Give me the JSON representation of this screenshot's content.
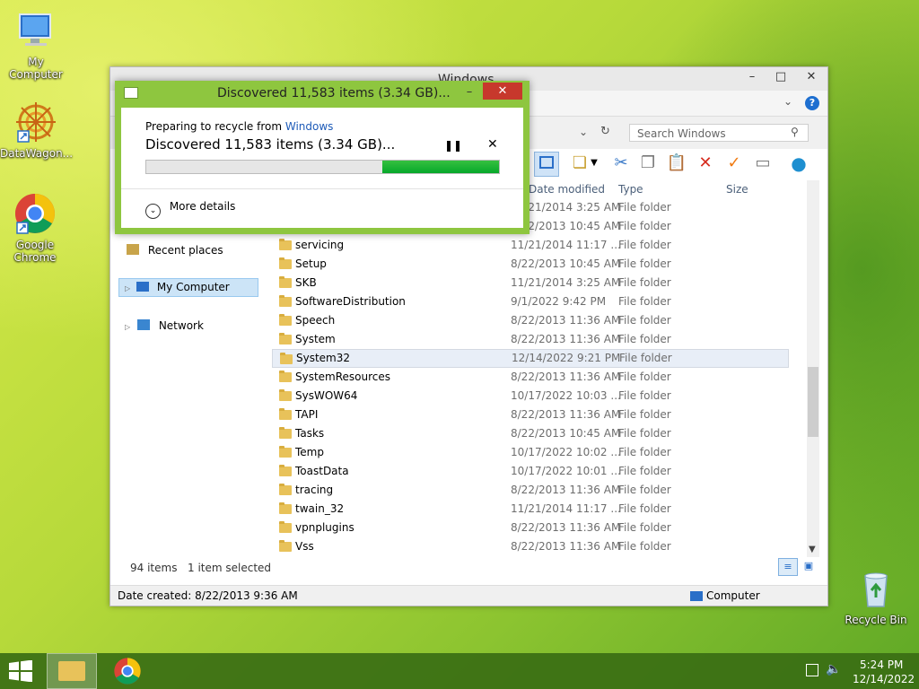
{
  "desktop": {
    "icons": [
      {
        "label": "My Computer",
        "icon": "computer-icon"
      },
      {
        "label": "DataWagon...",
        "icon": "datawagon-icon"
      },
      {
        "label": "Google Chrome",
        "icon": "chrome-icon"
      },
      {
        "label": "Recycle Bin",
        "icon": "recycle-bin-icon"
      }
    ]
  },
  "explorer": {
    "title": "Windows",
    "search_placeholder": "Search Windows",
    "columns": {
      "date": "Date modified",
      "type": "Type",
      "size": "Size"
    },
    "nav": {
      "recent_places": "Recent places",
      "my_computer": "My Computer",
      "network": "Network"
    },
    "partial_rows": [
      {
        "date": "11/21/2014 3:25 AM",
        "type": "File folder"
      },
      {
        "date": "8/22/2013 10:45 AM",
        "type": "File folder"
      }
    ],
    "rows": [
      {
        "name": "servicing",
        "date": "11/21/2014 11:17 ...",
        "type": "File folder"
      },
      {
        "name": "Setup",
        "date": "8/22/2013 10:45 AM",
        "type": "File folder"
      },
      {
        "name": "SKB",
        "date": "11/21/2014 3:25 AM",
        "type": "File folder"
      },
      {
        "name": "SoftwareDistribution",
        "date": "9/1/2022 9:42 PM",
        "type": "File folder"
      },
      {
        "name": "Speech",
        "date": "8/22/2013 11:36 AM",
        "type": "File folder"
      },
      {
        "name": "System",
        "date": "8/22/2013 11:36 AM",
        "type": "File folder"
      },
      {
        "name": "System32",
        "date": "12/14/2022 9:21 PM",
        "type": "File folder",
        "selected": true
      },
      {
        "name": "SystemResources",
        "date": "8/22/2013 11:36 AM",
        "type": "File folder"
      },
      {
        "name": "SysWOW64",
        "date": "10/17/2022 10:03 ...",
        "type": "File folder"
      },
      {
        "name": "TAPI",
        "date": "8/22/2013 11:36 AM",
        "type": "File folder"
      },
      {
        "name": "Tasks",
        "date": "8/22/2013 10:45 AM",
        "type": "File folder"
      },
      {
        "name": "Temp",
        "date": "10/17/2022 10:02 ...",
        "type": "File folder"
      },
      {
        "name": "ToastData",
        "date": "10/17/2022 10:01 ...",
        "type": "File folder"
      },
      {
        "name": "tracing",
        "date": "8/22/2013 11:36 AM",
        "type": "File folder"
      },
      {
        "name": "twain_32",
        "date": "11/21/2014 11:17 ...",
        "type": "File folder"
      },
      {
        "name": "vpnplugins",
        "date": "8/22/2013 11:36 AM",
        "type": "File folder"
      },
      {
        "name": "Vss",
        "date": "8/22/2013 11:36 AM",
        "type": "File folder"
      }
    ],
    "status": {
      "item_count": "94 items",
      "selected": "1 item selected",
      "date_created": "Date created: 8/22/2013 9:36 AM",
      "location": "Computer"
    }
  },
  "dialog": {
    "title": "Discovered 11,583 items (3.34 GB)...",
    "preparing_prefix": "Preparing to recycle from",
    "preparing_link": "Windows",
    "heading": "Discovered 11,583 items (3.34 GB)...",
    "progress_fraction": 0.33,
    "more_details": "More details"
  },
  "taskbar": {
    "time": "5:24 PM",
    "date": "12/14/2022"
  },
  "colors": {
    "dialog_accent": "#8ec63f",
    "progress": "#06a82a",
    "taskbar": "#3a6e14",
    "selection": "#e8eef7",
    "link": "#1e5bb8",
    "close_button": "#c7382c"
  }
}
